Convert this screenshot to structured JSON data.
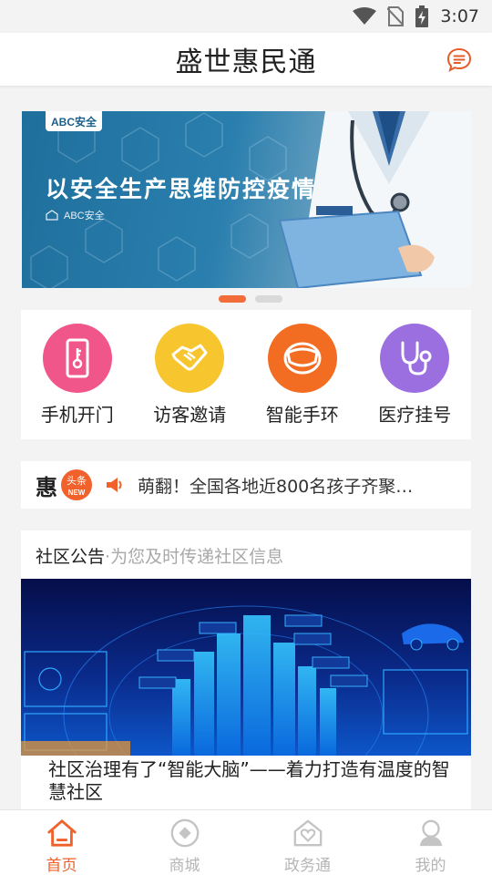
{
  "status_bar": {
    "time": "3:07"
  },
  "header": {
    "title": "盛世惠民通"
  },
  "banner": {
    "badge": "ABC安全",
    "headline": "以安全生产思维防控疫情",
    "sub_brand": "ABC安全",
    "active_slide": 1,
    "slide_count": 2
  },
  "quick_actions": [
    {
      "label": "手机开门",
      "icon": "phone-key-icon",
      "color": "#f0568a"
    },
    {
      "label": "访客邀请",
      "icon": "handshake-icon",
      "color": "#f7c52d"
    },
    {
      "label": "智能手环",
      "icon": "wristband-icon",
      "color": "#f26d22"
    },
    {
      "label": "医疗挂号",
      "icon": "stethoscope-icon",
      "color": "#9b6fe0"
    }
  ],
  "news": {
    "prefix": "惠",
    "logo_top": "头条",
    "logo_badge": "NEW",
    "headline": "萌翻！全国各地近800名孩子齐聚…"
  },
  "notice": {
    "title": "社区公告",
    "separator": "·",
    "subtitle": "为您及时传递社区信息",
    "article_title": "社区治理有了“智能大脑”——着力打造有温度的智慧社区"
  },
  "tabbar": [
    {
      "label": "首页",
      "icon": "home-icon",
      "active": true
    },
    {
      "label": "商城",
      "icon": "shop-icon",
      "active": false
    },
    {
      "label": "政务通",
      "icon": "government-icon",
      "active": false
    },
    {
      "label": "我的",
      "icon": "profile-icon",
      "active": false
    }
  ],
  "colors": {
    "accent": "#f0612b",
    "dot_inactive": "#d9d9d9"
  }
}
